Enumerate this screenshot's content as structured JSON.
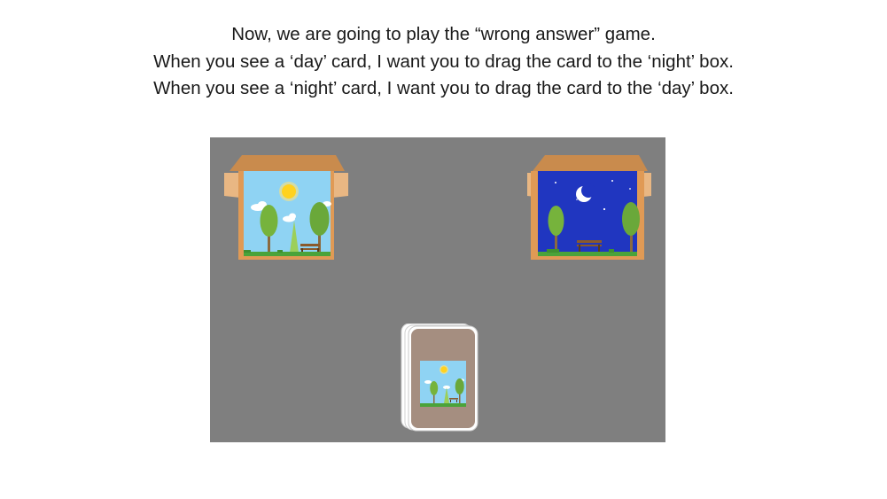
{
  "instructions": {
    "line1": "Now, we are going to play the “wrong answer” game.",
    "line2": "When you see a ‘day’ card, I want you to drag the card to the ‘night’ box.",
    "line3": "When you see a ‘night’ card, I want you to drag the card to the ‘day’ box."
  },
  "game": {
    "board_color": "#7f7f7f",
    "boxes": [
      {
        "id": "day",
        "scene": "day",
        "icon": "sun-icon"
      },
      {
        "id": "night",
        "scene": "night",
        "icon": "moon-icon"
      }
    ],
    "deck": {
      "current_card_scene": "day",
      "card_back_color": "#a58e80"
    }
  },
  "colors": {
    "day_sky": "#8fd3f3",
    "night_sky": "#2036c0",
    "box_cardboard": "#e09a55",
    "box_flap": "#c98b4d",
    "tree_green": "#76b33c",
    "grass": "#4aa33a"
  }
}
